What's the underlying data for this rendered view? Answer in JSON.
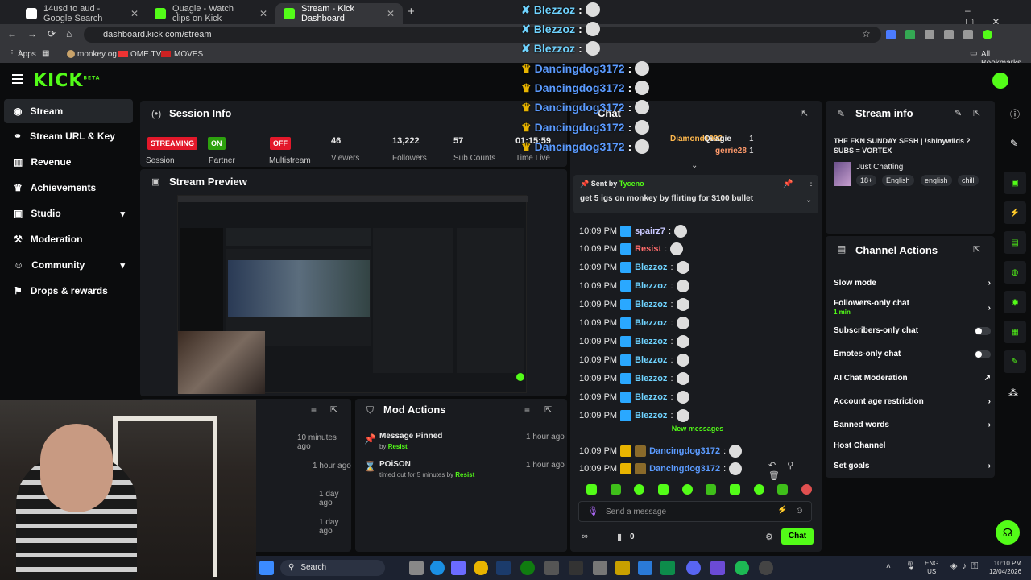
{
  "browser": {
    "tabs": [
      {
        "label": "14usd to aud - Google Search",
        "active": false,
        "favicon_color": "#4285f4"
      },
      {
        "label": "Quagie - Watch clips on Kick",
        "active": false,
        "favicon_color": "#53fc18"
      },
      {
        "label": "Stream - Kick Dashboard",
        "active": true,
        "favicon_color": "#53fc18"
      }
    ],
    "url": "dashboard.kick.com/stream",
    "bookmarks": [
      "Apps",
      "monkey og",
      "OME.TV",
      "MOVES"
    ],
    "all_bookmarks": "All Bookmarks"
  },
  "kick": {
    "logo": "KICK",
    "logo_sup": "BETA",
    "accent": "#53fc18"
  },
  "sidebar": {
    "items": [
      {
        "label": "Stream",
        "icon": "broadcast-icon",
        "selected": true,
        "chevron": false
      },
      {
        "label": "Stream URL & Key",
        "icon": "link-icon",
        "selected": false,
        "chevron": false
      },
      {
        "label": "Revenue",
        "icon": "revenue-icon",
        "selected": false,
        "chevron": false
      },
      {
        "label": "Achievements",
        "icon": "trophy-icon",
        "selected": false,
        "chevron": false
      },
      {
        "label": "Studio",
        "icon": "studio-icon",
        "selected": false,
        "chevron": true
      },
      {
        "label": "Moderation",
        "icon": "hammer-icon",
        "selected": false,
        "chevron": false
      },
      {
        "label": "Community",
        "icon": "community-icon",
        "selected": false,
        "chevron": true
      },
      {
        "label": "Drops & rewards",
        "icon": "gift-icon",
        "selected": false,
        "chevron": false
      }
    ]
  },
  "session": {
    "title": "Session Info",
    "streaming_badge": "STREAMING",
    "session_label": "Session",
    "partner_badge": "ON",
    "partner_label": "Partner",
    "multistream_badge": "OFF",
    "multistream_label": "Multistream",
    "viewers_value": "46",
    "viewers_label": "Viewers",
    "followers_value": "13,222",
    "followers_label": "Followers",
    "subs_value": "57",
    "subs_label": "Sub Counts",
    "time_value": "01:15:59",
    "time_label": "Time Live"
  },
  "preview": {
    "title": "Stream Preview"
  },
  "activity": {
    "times": [
      "10 minutes ago",
      "1 hour ago",
      "1 day ago",
      "1 day ago"
    ]
  },
  "mod_actions": {
    "title": "Mod Actions",
    "items": [
      {
        "title": "Message Pinned",
        "by_prefix": "by",
        "by_user": "Resist",
        "time": "1 hour ago"
      },
      {
        "title": "POiSON",
        "by_prefix": "timed out for 5 minutes by",
        "by_user": "Resist",
        "time": "1 hour ago"
      }
    ]
  },
  "chat": {
    "title": "Chat",
    "top_users": [
      {
        "name": "Diamond1992",
        "count": ""
      },
      {
        "name": "Quagie",
        "count": "1"
      },
      {
        "name": "gerrie28",
        "count": "1"
      }
    ],
    "pinned": {
      "sent_by_prefix": "Sent by",
      "sent_by_user": "Tyceno",
      "message": "get 5 igs on monkey by flirting for $100 bullet"
    },
    "messages": [
      {
        "time": "10:09 PM",
        "user": "spairz7",
        "color": "#c8c8ff",
        "sep": ":"
      },
      {
        "time": "10:09 PM",
        "user": "Resist",
        "color": "#ff6b6b",
        "sep": ":"
      },
      {
        "time": "10:09 PM",
        "user": "Blezzoz",
        "color": "#6fd3ff",
        "sep": ":"
      },
      {
        "time": "10:09 PM",
        "user": "Blezzoz",
        "color": "#6fd3ff",
        "sep": ":"
      },
      {
        "time": "10:09 PM",
        "user": "Blezzoz",
        "color": "#6fd3ff",
        "sep": ":"
      },
      {
        "time": "10:09 PM",
        "user": "Blezzoz",
        "color": "#6fd3ff",
        "sep": ":"
      },
      {
        "time": "10:09 PM",
        "user": "Blezzoz",
        "color": "#6fd3ff",
        "sep": ":"
      },
      {
        "time": "10:09 PM",
        "user": "Blezzoz",
        "color": "#6fd3ff",
        "sep": ":"
      },
      {
        "time": "10:09 PM",
        "user": "Blezzoz",
        "color": "#6fd3ff",
        "sep": ":"
      },
      {
        "time": "10:09 PM",
        "user": "Blezzoz",
        "color": "#6fd3ff",
        "sep": ":"
      },
      {
        "time": "10:09 PM",
        "user": "Blezzoz",
        "color": "#6fd3ff",
        "sep": ":"
      }
    ],
    "new_messages": "New messages",
    "new_msgs": [
      {
        "time": "10:09 PM",
        "user": "Dancingdog3172",
        "color": "#5b9bff",
        "sep": ":"
      },
      {
        "time": "10:09 PM",
        "user": "Dancingdog3172",
        "color": "#5b9bff",
        "sep": ":"
      }
    ],
    "input_placeholder": "Send a message",
    "points_value": "0",
    "send_label": "Chat"
  },
  "overlay": {
    "lines": [
      {
        "user": "Blezzoz",
        "sep": ":",
        "color": "#6fd3ff"
      },
      {
        "user": "Blezzoz",
        "sep": ":",
        "color": "#6fd3ff"
      },
      {
        "user": "Blezzoz",
        "sep": ":",
        "color": "#6fd3ff"
      },
      {
        "user": "Dancingdog3172",
        "sep": ":",
        "color": "#5b9bff"
      },
      {
        "user": "Dancingdog3172",
        "sep": ":",
        "color": "#5b9bff"
      },
      {
        "user": "Dancingdog3172",
        "sep": ":",
        "color": "#5b9bff"
      },
      {
        "user": "Dancingdog3172",
        "sep": ":",
        "color": "#5b9bff"
      },
      {
        "user": "Dancingdog3172",
        "sep": ":",
        "color": "#5b9bff"
      }
    ]
  },
  "stream_info": {
    "title": "Stream info",
    "stream_title": "THE FKN SUNDAY SESH | !shinywilds 2 SUBS = VORTEX",
    "category": "Just Chatting",
    "tags": [
      "18+",
      "English",
      "english",
      "chill"
    ]
  },
  "channel_actions": {
    "title": "Channel Actions",
    "items": [
      {
        "label": "Slow mode",
        "sub": "",
        "control": "chevron"
      },
      {
        "label": "Followers-only chat",
        "sub": "1 min",
        "control": "chevron"
      },
      {
        "label": "Subscribers-only chat",
        "sub": "",
        "control": "toggle"
      },
      {
        "label": "Emotes-only chat",
        "sub": "",
        "control": "toggle"
      },
      {
        "label": "AI Chat Moderation",
        "sub": "",
        "control": "external"
      },
      {
        "label": "Account age restriction",
        "sub": "",
        "control": "chevron"
      },
      {
        "label": "Banned words",
        "sub": "",
        "control": "chevron"
      },
      {
        "label": "Host Channel",
        "sub": "",
        "control": "none"
      },
      {
        "label": "Set goals",
        "sub": "",
        "control": "chevron"
      }
    ]
  },
  "taskbar": {
    "search": "Search",
    "lang_top": "ENG",
    "lang_bottom": "US",
    "time": "10:10 PM",
    "date": "12/04/2026"
  }
}
